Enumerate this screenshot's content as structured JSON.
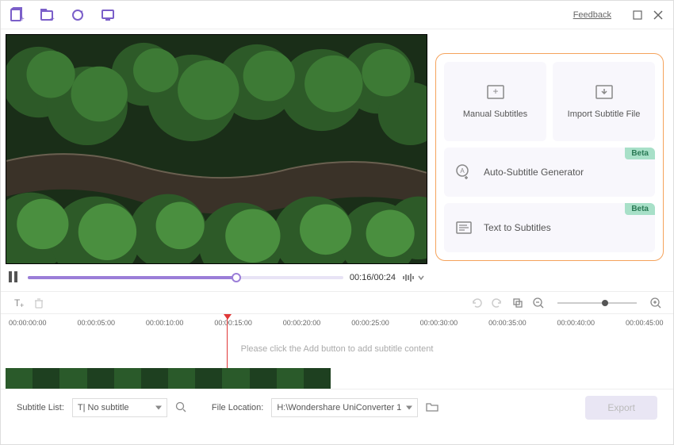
{
  "titlebar": {
    "feedback": "Feedback"
  },
  "player": {
    "timecode": "00:16/00:24"
  },
  "panel": {
    "manual": "Manual Subtitles",
    "import": "Import Subtitle File",
    "auto": "Auto-Subtitle Generator",
    "text": "Text to Subtitles",
    "beta": "Beta"
  },
  "timeline": {
    "ticks": [
      "00:00:00:00",
      "00:00:05:00",
      "00:00:10:00",
      "00:00:15:00",
      "00:00:20:00",
      "00:00:25:00",
      "00:00:30:00",
      "00:00:35:00",
      "00:00:40:00",
      "00:00:45:00"
    ],
    "hint": "Please click the Add button to add subtitle content"
  },
  "bottom": {
    "subtitle_list_label": "Subtitle List:",
    "subtitle_list_value": "T| No subtitle",
    "file_location_label": "File Location:",
    "file_location_value": "H:\\Wondershare UniConverter 1",
    "export": "Export"
  }
}
